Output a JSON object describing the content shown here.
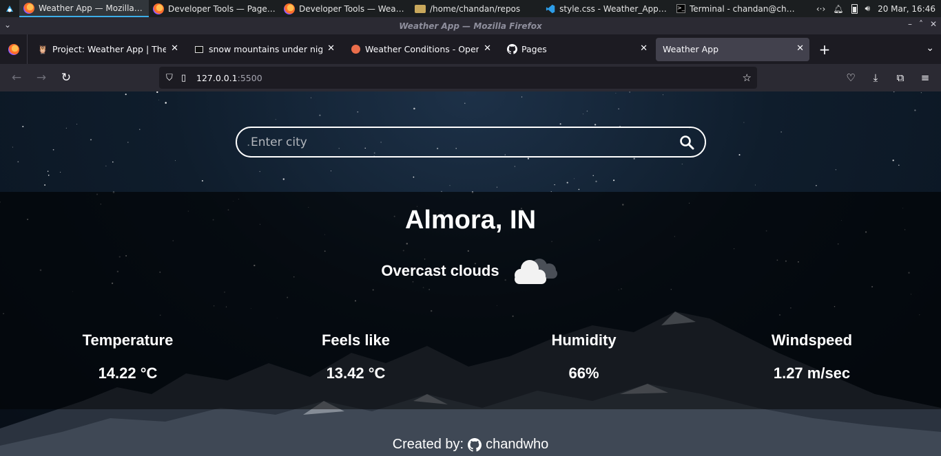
{
  "taskbar": {
    "tasks": [
      {
        "label": "Weather App — Mozilla Fir..."
      },
      {
        "label": "Developer Tools — Pages ..."
      },
      {
        "label": "Developer Tools — Weathe..."
      },
      {
        "label": "/home/chandan/repos"
      },
      {
        "label": "style.css - Weather_App - Vi..."
      },
      {
        "label": "Terminal - chandan@chand..."
      }
    ],
    "clock": "20 Mar, 16:46"
  },
  "window": {
    "title": "Weather App — Mozilla Firefox"
  },
  "tabs": [
    {
      "label": "Project: Weather App | The Od",
      "icon": "odin-icon"
    },
    {
      "label": "snow mountains under nights",
      "icon": "image-icon"
    },
    {
      "label": "Weather Conditions - OpenWe",
      "icon": "openweather-icon"
    },
    {
      "label": "Pages",
      "icon": "github-icon"
    },
    {
      "label": "Weather App",
      "icon": "none"
    }
  ],
  "urlbar": {
    "host": "127.0.0.1",
    "port": ":5500"
  },
  "search": {
    "placeholder": "Enter city"
  },
  "weather": {
    "city": "Almora, IN",
    "condition": "Overcast clouds",
    "stats": [
      {
        "label": "Temperature",
        "value": "14.22 °C"
      },
      {
        "label": "Feels like",
        "value": "13.42 °C"
      },
      {
        "label": "Humidity",
        "value": "66%"
      },
      {
        "label": "Windspeed",
        "value": "1.27 m/sec"
      }
    ]
  },
  "footer": {
    "prefix": "Created by:",
    "author": "chandwho"
  },
  "colors": {
    "accent": "#3daee9",
    "toolbar": "#2b2a33",
    "tabstrip": "#1c1b22",
    "card": "#000000"
  }
}
